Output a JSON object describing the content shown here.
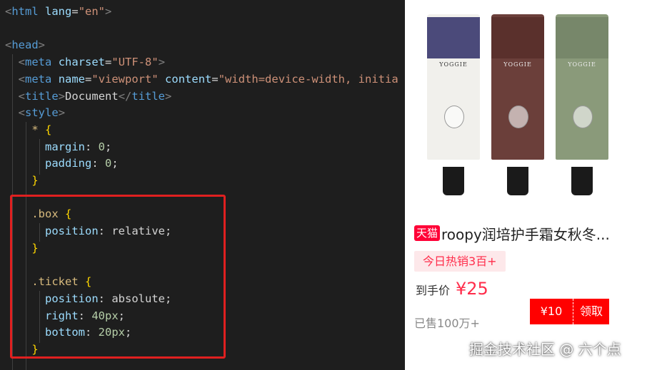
{
  "editor": {
    "lines": [
      {
        "parts": [
          [
            "punct",
            "<"
          ],
          [
            "tag",
            "html"
          ],
          [
            "txt",
            " "
          ],
          [
            "attr",
            "lang"
          ],
          [
            "txt",
            "="
          ],
          [
            "str",
            "\"en\""
          ],
          [
            "punct",
            ">"
          ]
        ]
      },
      {
        "parts": []
      },
      {
        "parts": [
          [
            "punct",
            "<"
          ],
          [
            "tag",
            "head"
          ],
          [
            "punct",
            ">"
          ]
        ]
      },
      {
        "parts": [
          [
            "txt",
            "  "
          ],
          [
            "punct",
            "<"
          ],
          [
            "tag",
            "meta"
          ],
          [
            "txt",
            " "
          ],
          [
            "attr",
            "charset"
          ],
          [
            "txt",
            "="
          ],
          [
            "str",
            "\"UTF-8\""
          ],
          [
            "punct",
            ">"
          ]
        ]
      },
      {
        "parts": [
          [
            "txt",
            "  "
          ],
          [
            "punct",
            "<"
          ],
          [
            "tag",
            "meta"
          ],
          [
            "txt",
            " "
          ],
          [
            "attr",
            "name"
          ],
          [
            "txt",
            "="
          ],
          [
            "str",
            "\"viewport\""
          ],
          [
            "txt",
            " "
          ],
          [
            "attr",
            "content"
          ],
          [
            "txt",
            "="
          ],
          [
            "str",
            "\"width=device-width, initia"
          ]
        ]
      },
      {
        "parts": [
          [
            "txt",
            "  "
          ],
          [
            "punct",
            "<"
          ],
          [
            "tag",
            "title"
          ],
          [
            "punct",
            ">"
          ],
          [
            "txt",
            "Document"
          ],
          [
            "punct",
            "</"
          ],
          [
            "tag",
            "title"
          ],
          [
            "punct",
            ">"
          ]
        ]
      },
      {
        "parts": [
          [
            "txt",
            "  "
          ],
          [
            "punct",
            "<"
          ],
          [
            "tag",
            "style"
          ],
          [
            "punct",
            ">"
          ]
        ]
      },
      {
        "parts": [
          [
            "txt",
            "    "
          ],
          [
            "sel",
            "*"
          ],
          [
            "txt",
            " "
          ],
          [
            "brace",
            "{"
          ]
        ]
      },
      {
        "parts": [
          [
            "txt",
            "      "
          ],
          [
            "prop",
            "margin"
          ],
          [
            "txt",
            ": "
          ],
          [
            "num",
            "0"
          ],
          [
            "txt",
            ";"
          ]
        ]
      },
      {
        "parts": [
          [
            "txt",
            "      "
          ],
          [
            "prop",
            "padding"
          ],
          [
            "txt",
            ": "
          ],
          [
            "num",
            "0"
          ],
          [
            "txt",
            ";"
          ]
        ]
      },
      {
        "parts": [
          [
            "txt",
            "    "
          ],
          [
            "brace",
            "}"
          ]
        ]
      },
      {
        "parts": []
      },
      {
        "parts": [
          [
            "txt",
            "    "
          ],
          [
            "sel",
            ".box"
          ],
          [
            "txt",
            " "
          ],
          [
            "brace",
            "{"
          ]
        ]
      },
      {
        "parts": [
          [
            "txt",
            "      "
          ],
          [
            "prop",
            "position"
          ],
          [
            "txt",
            ": "
          ],
          [
            "val",
            "relative"
          ],
          [
            "txt",
            ";"
          ]
        ]
      },
      {
        "parts": [
          [
            "txt",
            "    "
          ],
          [
            "brace",
            "}"
          ]
        ]
      },
      {
        "parts": []
      },
      {
        "parts": [
          [
            "txt",
            "    "
          ],
          [
            "sel",
            ".ticket"
          ],
          [
            "txt",
            " "
          ],
          [
            "brace",
            "{"
          ]
        ]
      },
      {
        "parts": [
          [
            "txt",
            "      "
          ],
          [
            "prop",
            "position"
          ],
          [
            "txt",
            ": "
          ],
          [
            "val",
            "absolute"
          ],
          [
            "txt",
            ";"
          ]
        ]
      },
      {
        "parts": [
          [
            "txt",
            "      "
          ],
          [
            "prop",
            "right"
          ],
          [
            "txt",
            ": "
          ],
          [
            "num",
            "40px"
          ],
          [
            "txt",
            ";"
          ]
        ]
      },
      {
        "parts": [
          [
            "txt",
            "      "
          ],
          [
            "prop",
            "bottom"
          ],
          [
            "txt",
            ": "
          ],
          [
            "num",
            "20px"
          ],
          [
            "txt",
            ";"
          ]
        ]
      },
      {
        "parts": [
          [
            "txt",
            "    "
          ],
          [
            "brace",
            "}"
          ]
        ]
      }
    ]
  },
  "product": {
    "tmall_badge": "天猫",
    "title": "roopy润培护手霜女秋冬...",
    "hot_tag": "今日热销3百+",
    "price_label": "到手价",
    "price_value": "¥25",
    "coupon_amount": "¥10",
    "coupon_claim": "领取",
    "sold": "已售100万+",
    "tube_brand": "YOGGIE",
    "tube_colors": [
      "#4b4a7a",
      "#6b3f3a",
      "#8a9a7a"
    ]
  },
  "watermark": "掘金技术社区 @ 六个点",
  "colors": {
    "accent_red": "#ff0000",
    "price_red": "#ff2d4b",
    "tmall_red": "#ff0036",
    "highlight_border": "#e02020"
  }
}
